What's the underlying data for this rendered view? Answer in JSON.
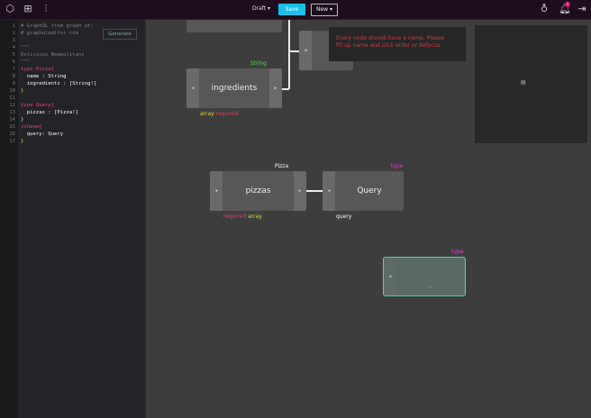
{
  "topbar": {
    "draft_label": "Draft",
    "save_label": "Save",
    "new_label": "New",
    "notification_count": "1"
  },
  "editor": {
    "generate_label": "Generate",
    "line_numbers": [
      "1",
      "2",
      "3",
      "4",
      "5",
      "6",
      "7",
      "8",
      "9",
      "10",
      "11",
      "12",
      "13",
      "14",
      "15",
      "16",
      "17"
    ],
    "lines": [
      "# GraphQL from graph at:",
      "# graphqleditor.com",
      "",
      "\"\"\"",
      "Delicious Neapolitans",
      "\"\"\"",
      "type Pizza{",
      "  name : String",
      "  ingredients : [String!]",
      "}",
      "",
      "type Query{",
      "  pizzas : [Pizza!]",
      "}",
      "schema{",
      "  query: Query",
      "}"
    ]
  },
  "canvas": {
    "error_message_1": "Every node should have a name. Please",
    "error_message_2": "fill up name and click enter or defocus",
    "nodes": {
      "ingredients": {
        "name": "ingredients",
        "type_label": "String",
        "tag1": "array",
        "tag2": "required"
      },
      "pizzas": {
        "name": "pizzas",
        "type_label": "Pizza",
        "tag1": "required",
        "tag2": "array"
      },
      "query": {
        "name": "Query",
        "type_label": "type",
        "sub_label": "query"
      },
      "new_node": {
        "type_label": "type"
      }
    }
  },
  "colors": {
    "accent_save": "#19c0e8",
    "type_label": "#e43fd6",
    "selected_border": "#5ed3a2",
    "error_text": "#d03a48"
  }
}
